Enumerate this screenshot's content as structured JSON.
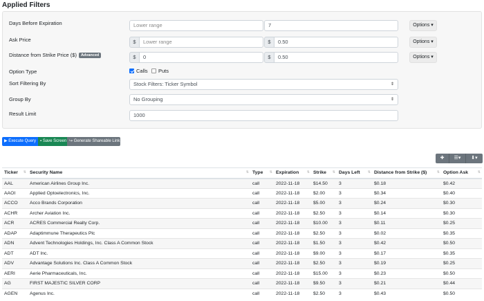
{
  "title": "Applied Filters",
  "filters": {
    "days": {
      "label": "Days Before Expiration",
      "lower_placeholder": "Lower range",
      "upper_value": "7",
      "options_label": "Options"
    },
    "ask": {
      "label": "Ask Price",
      "lower_prefix": "$",
      "lower_placeholder": "Lower range",
      "upper_prefix": "$",
      "upper_value": "0.50",
      "options_label": "Options"
    },
    "distance": {
      "label": "Distance from Strike Price ($)",
      "badge": "Advanced",
      "lower_prefix": "$",
      "lower_value": "0",
      "upper_prefix": "$",
      "upper_value": "0.50",
      "options_label": "Options"
    },
    "option_type": {
      "label": "Option Type",
      "calls_label": "Calls",
      "calls_checked": true,
      "puts_label": "Puts",
      "puts_checked": false
    },
    "sort_by": {
      "label": "Sort Filtering By",
      "value": "Stock Filters: Ticker Symbol"
    },
    "group_by": {
      "label": "Group By",
      "value": "No Grouping"
    },
    "limit": {
      "label": "Result Limit",
      "value": "1000"
    }
  },
  "actions": {
    "execute": "Execute Query",
    "save": "Save Screen",
    "share": "Generate Shareable Link"
  },
  "colors": {
    "primary": "#0d6efd",
    "success": "#198754",
    "secondary": "#6c757d"
  },
  "table": {
    "headers": [
      "Ticker",
      "Security Name",
      "Type",
      "Expiration",
      "Strike",
      "Days Left",
      "Distance from Strike ($)",
      "Option Ask"
    ],
    "rows": [
      [
        "AAL",
        "American Airlines Group Inc.",
        "call",
        "2022-11-18",
        "$14.50",
        "3",
        "$0.18",
        "$0.42"
      ],
      [
        "AAOI",
        "Applied Optoelectronics, Inc.",
        "call",
        "2022-11-18",
        "$2.00",
        "3",
        "$0.34",
        "$0.40"
      ],
      [
        "ACCO",
        "Acco Brands Corporation",
        "call",
        "2022-11-18",
        "$5.00",
        "3",
        "$0.24",
        "$0.30"
      ],
      [
        "ACHR",
        "Archer Aviation Inc.",
        "call",
        "2022-11-18",
        "$2.50",
        "3",
        "$0.14",
        "$0.30"
      ],
      [
        "ACR",
        "ACRES Commercial Realty Corp.",
        "call",
        "2022-11-18",
        "$10.00",
        "3",
        "$0.11",
        "$0.25"
      ],
      [
        "ADAP",
        "Adaptimmune Therapeutics Plc",
        "call",
        "2022-11-18",
        "$2.50",
        "3",
        "$0.02",
        "$0.35"
      ],
      [
        "ADN",
        "Advent Technologies Holdings, Inc. Class A Common Stock",
        "call",
        "2022-11-18",
        "$1.50",
        "3",
        "$0.42",
        "$0.50"
      ],
      [
        "ADT",
        "ADT Inc.",
        "call",
        "2022-11-18",
        "$9.00",
        "3",
        "$0.17",
        "$0.35"
      ],
      [
        "ADV",
        "Advantage Solutions Inc. Class A Common Stock",
        "call",
        "2022-11-18",
        "$2.50",
        "3",
        "$0.19",
        "$0.25"
      ],
      [
        "AERI",
        "Aerie Pharmaceuticals, Inc.",
        "call",
        "2022-11-18",
        "$15.00",
        "3",
        "$0.23",
        "$0.50"
      ],
      [
        "AG",
        "FIRST MAJESTIC SILVER CORP",
        "call",
        "2022-11-18",
        "$9.50",
        "3",
        "$0.21",
        "$0.44"
      ],
      [
        "AGEN",
        "Agenus Inc.",
        "call",
        "2022-11-18",
        "$2.50",
        "3",
        "$0.43",
        "$0.50"
      ]
    ]
  }
}
